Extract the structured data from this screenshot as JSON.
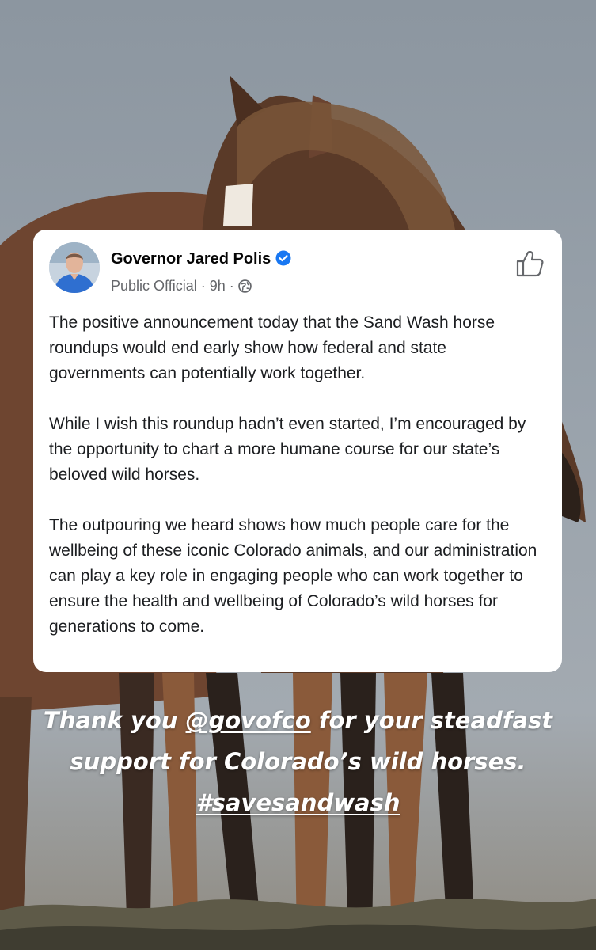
{
  "post": {
    "author_name": "Governor Jared Polis",
    "author_category": "Public Official",
    "separator": "·",
    "time_ago": "9h",
    "paragraphs": [
      "The positive announcement today that the Sand Wash horse roundups would end early show how federal and state governments can potentially work together.",
      "While I wish this roundup hadn’t even started, I’m encouraged by the opportunity to chart a more humane course for our state’s beloved wild horses.",
      "The outpouring we heard shows how much people care for the wellbeing of these iconic Colorado animals, and our administration can play a key role in engaging people who can work together to ensure the health and wellbeing of Colorado’s wild horses for generations to come."
    ]
  },
  "caption": {
    "part1": "Thank you ",
    "mention": "@govofco",
    "part2": " for your steadfast support for Colorado’s wild horses. ",
    "hashtag": "#savesandwash"
  },
  "colors": {
    "verified_blue": "#1877f2",
    "meta_gray": "#65676b",
    "card_bg": "#ffffff",
    "caption_text": "#ffffff"
  },
  "icons": {
    "verified": "verified-badge-icon",
    "audience": "globe-icon",
    "reaction": "thumbs-up-icon"
  }
}
